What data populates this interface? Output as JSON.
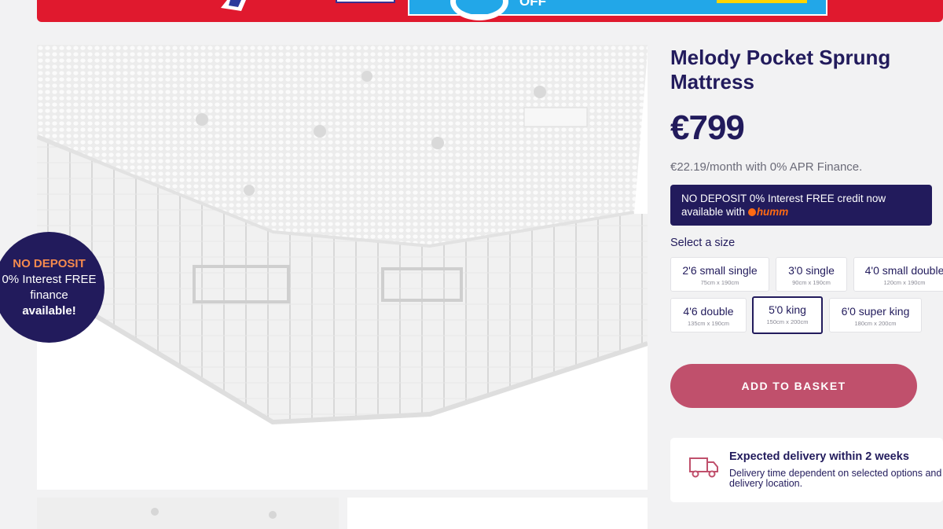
{
  "promo_banner": {
    "off_text": "OFF"
  },
  "finance_badge": {
    "line1": "NO DEPOSIT",
    "line2": "0% Interest FREE",
    "line3": "finance",
    "line4": "available!"
  },
  "product": {
    "title": "Melody Pocket Sprung Mattress",
    "price": "€799",
    "monthly": "€22.19/month with 0% APR Finance."
  },
  "credit_banner": {
    "text_line1": "NO DEPOSIT 0% Interest FREE credit now",
    "text_line2": "available with",
    "provider": "humm"
  },
  "size_selector": {
    "label": "Select a size",
    "selected": "5'0 king",
    "options": [
      {
        "name": "2'6 small single",
        "dims": "75cm x 190cm"
      },
      {
        "name": "3'0 single",
        "dims": "90cm x 190cm"
      },
      {
        "name": "4'0 small double",
        "dims": "120cm x 190cm"
      },
      {
        "name": "4'6 double",
        "dims": "135cm x 190cm"
      },
      {
        "name": "5'0 king",
        "dims": "150cm x 200cm"
      },
      {
        "name": "6'0 super king",
        "dims": "180cm x 200cm"
      }
    ]
  },
  "basket": {
    "label": "ADD TO BASKET"
  },
  "delivery": {
    "icon": "truck-icon",
    "title": "Expected delivery within 2 weeks",
    "description": "Delivery time dependent on selected options and delivery location."
  },
  "colors": {
    "brand_navy": "#221b5c",
    "basket_pink": "#c0506c",
    "promo_red": "#e0192e",
    "promo_blue": "#22a7e8",
    "humm_orange": "#ff6a13"
  }
}
